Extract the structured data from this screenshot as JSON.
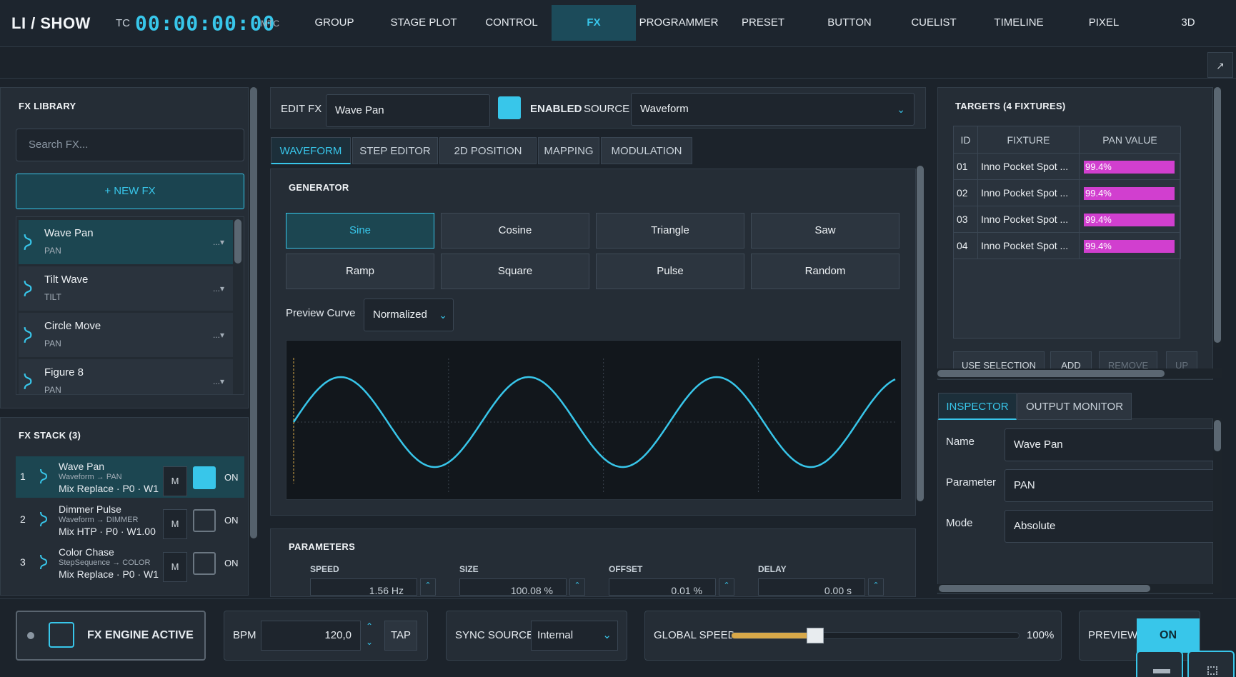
{
  "app": {
    "title": "LI / SHOW",
    "tc_label": "TC",
    "timecode": "00:00:00:00",
    "mtc_label": "MTC"
  },
  "nav": {
    "tabs": [
      {
        "label": "GROUP"
      },
      {
        "label": "STAGE PLOT"
      },
      {
        "label": "CONTROL"
      },
      {
        "label": "FX",
        "active": true
      },
      {
        "label": "PROGRAMMER"
      },
      {
        "label": "PRESET"
      },
      {
        "label": "BUTTON"
      },
      {
        "label": "CUELIST"
      },
      {
        "label": "TIMELINE"
      },
      {
        "label": "PIXEL"
      },
      {
        "label": "3D"
      }
    ],
    "expand_icon": "↗"
  },
  "library": {
    "title": "FX LIBRARY",
    "search_placeholder": "Search FX...",
    "new_fx_label": "+ NEW FX",
    "items": [
      {
        "name": "Wave Pan",
        "param": "PAN",
        "more": "...▾",
        "selected": true
      },
      {
        "name": "Tilt Wave",
        "param": "TILT",
        "more": "...▾"
      },
      {
        "name": "Circle Move",
        "param": "PAN",
        "more": "...▾"
      },
      {
        "name": "Figure 8",
        "param": "PAN",
        "more": "...▾"
      }
    ]
  },
  "stack": {
    "title": "FX STACK (3)",
    "rows": [
      {
        "num": "1",
        "name": "Wave Pan",
        "route": "Waveform → PAN",
        "mix": "Mix Replace · P0 · W1",
        "m": "M",
        "on": "ON",
        "enabled": true
      },
      {
        "num": "2",
        "name": "Dimmer Pulse",
        "route": "Waveform → DIMMER",
        "mix": "Mix HTP · P0 · W1.00",
        "m": "M",
        "on": "ON",
        "enabled": false
      },
      {
        "num": "3",
        "name": "Color Chase",
        "route": "StepSequence → COLOR",
        "mix": "Mix Replace · P0 · W1",
        "m": "M",
        "on": "ON",
        "enabled": false
      }
    ]
  },
  "edit": {
    "label": "EDIT FX",
    "name_value": "Wave Pan",
    "enabled_label": "ENABLED",
    "source_label": "SOURCE",
    "source_value": "Waveform",
    "tabs": [
      {
        "label": "WAVEFORM",
        "active": true
      },
      {
        "label": "STEP EDITOR"
      },
      {
        "label": "2D POSITION"
      },
      {
        "label": "MAPPING"
      },
      {
        "label": "MODULATION"
      }
    ],
    "generator_title": "GENERATOR",
    "generators": [
      "Sine",
      "Cosine",
      "Triangle",
      "Saw",
      "Ramp",
      "Square",
      "Pulse",
      "Random"
    ],
    "active_generator": "Sine",
    "preview_label": "Preview Curve",
    "preview_mode": "Normalized",
    "waveform": {
      "type": "sine",
      "cycles": 3.2,
      "accent": "#38c6ea"
    },
    "parameters_title": "PARAMETERS",
    "params": [
      {
        "label": "SPEED",
        "value": "1.56 Hz"
      },
      {
        "label": "SIZE",
        "value": "100.08 %"
      },
      {
        "label": "OFFSET",
        "value": "0.01 %"
      },
      {
        "label": "DELAY",
        "value": "0.00 s"
      }
    ]
  },
  "targets": {
    "title": "TARGETS (4 FIXTURES)",
    "headers": [
      "ID",
      "FIXTURE",
      "PAN VALUE"
    ],
    "rows": [
      {
        "id": "01",
        "fixture": "Inno Pocket Spot ...",
        "pan": "99.4%",
        "level": 0.994
      },
      {
        "id": "02",
        "fixture": "Inno Pocket Spot ...",
        "pan": "99.4%",
        "level": 0.994
      },
      {
        "id": "03",
        "fixture": "Inno Pocket Spot ...",
        "pan": "99.4%",
        "level": 0.994
      },
      {
        "id": "04",
        "fixture": "Inno Pocket Spot ...",
        "pan": "99.4%",
        "level": 0.994
      }
    ],
    "buttons": [
      "USE SELECTION",
      "ADD",
      "REMOVE",
      "UP"
    ]
  },
  "inspector": {
    "tabs": [
      {
        "label": "INSPECTOR",
        "active": true
      },
      {
        "label": "OUTPUT MONITOR"
      }
    ],
    "fields": [
      {
        "label": "Name",
        "value": "Wave Pan"
      },
      {
        "label": "Parameter",
        "value": "PAN"
      },
      {
        "label": "Mode",
        "value": "Absolute"
      }
    ]
  },
  "bottom": {
    "engine_label": "FX ENGINE ACTIVE",
    "bpm_label": "BPM",
    "bpm_value": "120,0",
    "tap_label": "TAP",
    "sync_label": "SYNC SOURCE",
    "sync_value": "Internal",
    "speed_label": "GLOBAL SPEED",
    "speed_value": "100%",
    "speed_level": 0.27,
    "preview_label": "PREVIEW",
    "preview_state": "ON"
  },
  "colors": {
    "accent": "#38c6ea",
    "pan_bar": "#d13fcf",
    "speed_fill": "#d8a849"
  }
}
